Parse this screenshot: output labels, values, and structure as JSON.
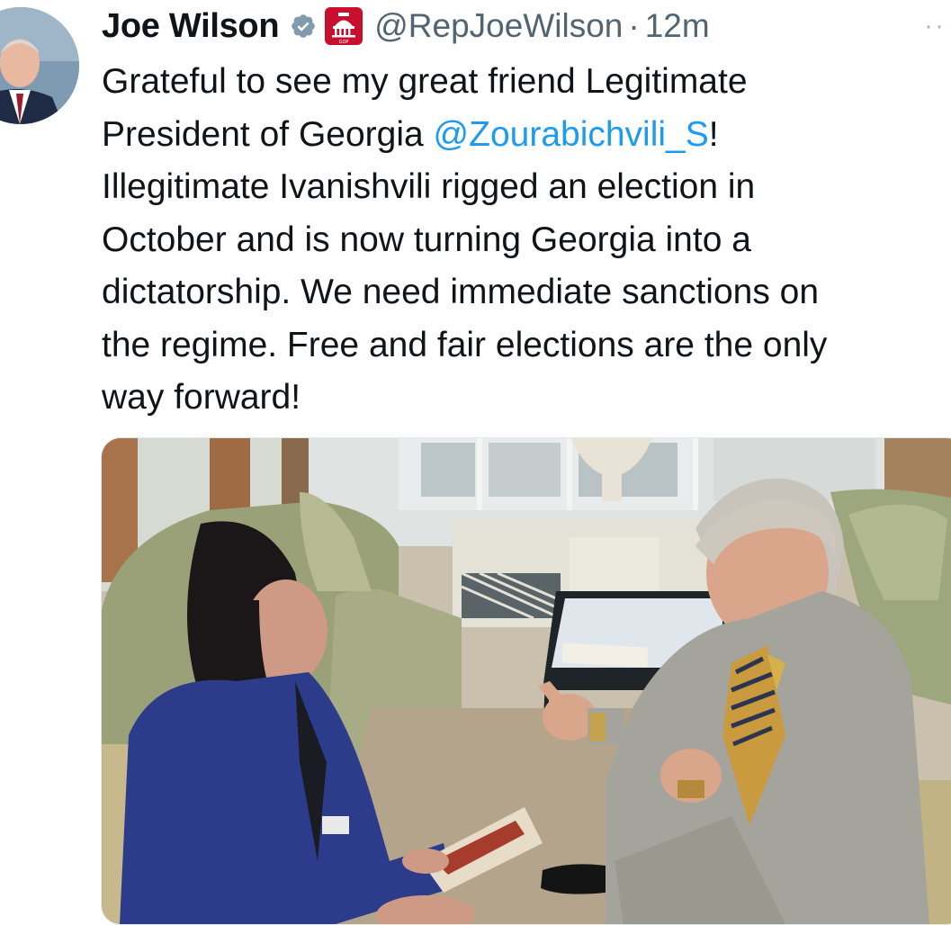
{
  "author": {
    "display_name": "Joe Wilson",
    "handle": "@RepJoeWilson",
    "separator": "·",
    "timestamp": "12m",
    "verified_icon": "verified-badge-icon",
    "affiliation_icon": "capitol-gop-icon",
    "affiliation_badge_text": "GOP"
  },
  "tweet": {
    "lines": [
      {
        "pre": "Grateful to see my great friend Legitimate",
        "mention": "",
        "post": ""
      },
      {
        "pre": "President of Georgia ",
        "mention": "@Zourabichvili_S",
        "post": "!"
      },
      {
        "pre": "Illegitimate Ivanishvili rigged an election in",
        "mention": "",
        "post": ""
      },
      {
        "pre": "October and is now turning Georgia into a",
        "mention": "",
        "post": ""
      },
      {
        "pre": "dictatorship. We need immediate sanctions on",
        "mention": "",
        "post": ""
      },
      {
        "pre": "the regime. Free and fair elections are the only",
        "mention": "",
        "post": ""
      },
      {
        "pre": "way forward!",
        "mention": "",
        "post": ""
      }
    ]
  },
  "actions": {
    "more_icon": "more-options-icon",
    "more_label": "··"
  },
  "media": {
    "kind": "photo"
  },
  "colors": {
    "text": "#0f1419",
    "secondary": "#536471",
    "link": "#1d9bf0",
    "badge_red": "#c8102e",
    "verified_gray": "#829aab"
  }
}
